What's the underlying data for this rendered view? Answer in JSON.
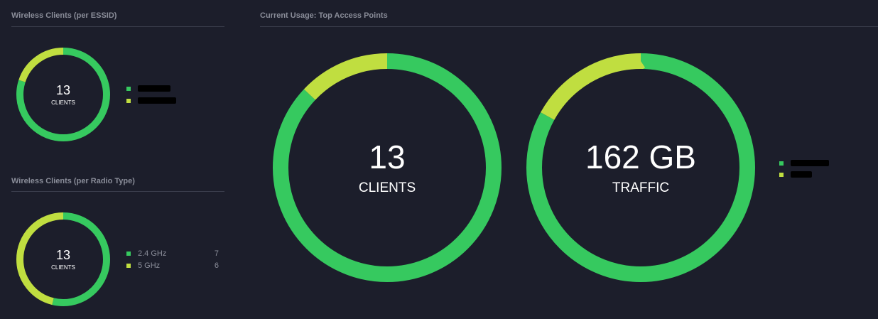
{
  "colors": {
    "background": "#1c1e2b",
    "green": "#36c95f",
    "lime": "#c0de40",
    "muted_text": "#8a8d99"
  },
  "essid_panel": {
    "title": "Wireless Clients (per ESSID)",
    "value": "13",
    "unit": "CLIENTS",
    "segments": [
      {
        "color": "#36c95f",
        "fraction": 0.8,
        "label_redacted": true
      },
      {
        "color": "#c0de40",
        "fraction": 0.2,
        "label_redacted": true
      }
    ]
  },
  "radio_panel": {
    "title": "Wireless Clients (per Radio Type)",
    "value": "13",
    "unit": "CLIENTS",
    "segments": [
      {
        "color": "#36c95f",
        "label": "2.4 GHz",
        "count": "7",
        "fraction": 0.538
      },
      {
        "color": "#c0de40",
        "label": "5 GHz",
        "count": "6",
        "fraction": 0.462
      }
    ]
  },
  "top_ap_panel": {
    "title": "Current Usage: Top Access Points",
    "clients": {
      "value": "13",
      "unit": "CLIENTS",
      "segments": [
        {
          "color": "#36c95f",
          "fraction": 0.87
        },
        {
          "color": "#c0de40",
          "fraction": 0.13
        }
      ]
    },
    "traffic": {
      "value": "162 GB",
      "unit": "TRAFFIC",
      "segments": [
        {
          "color": "#36c95f",
          "fraction": 0.83
        },
        {
          "color": "#c0de40",
          "fraction": 0.17
        }
      ]
    },
    "legend": [
      {
        "color": "#36c95f",
        "label_redacted": true
      },
      {
        "color": "#c0de40",
        "label_redacted": true
      }
    ]
  }
}
